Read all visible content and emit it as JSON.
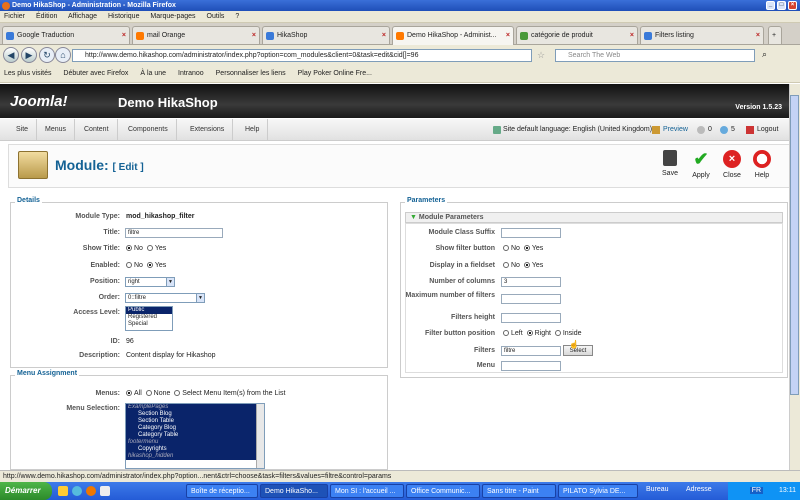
{
  "window": {
    "title": "Demo HikaShop - Administration - Mozilla Firefox"
  },
  "menubar": [
    "Fichier",
    "Édition",
    "Affichage",
    "Historique",
    "Marque-pages",
    "Outils",
    "?"
  ],
  "tabs": [
    {
      "label": "Google Traduction",
      "color": "#3a7ad9"
    },
    {
      "label": "mail Orange",
      "color": "#ff7900"
    },
    {
      "label": "HikaShop",
      "color": "#3a7ad9"
    },
    {
      "label": "Demo HikaShop - Administ...",
      "color": "#ff7900"
    },
    {
      "label": "catégorie de produit",
      "color": "#4a9a3a"
    },
    {
      "label": "Filters listing",
      "color": "#3a7ad9"
    }
  ],
  "url": "http://www.demo.hikashop.com/administrator/index.php?option=com_modules&client=0&task=edit&cid[]=96",
  "search_placeholder": "Search The Web",
  "bookmarks": [
    "Les plus visités",
    "Débuter avec Firefox",
    "À la une",
    "Intranoo",
    "Personnaliser les liens",
    "Play Poker Online Fre..."
  ],
  "joomla": {
    "logo": "Joomla!",
    "site": "Demo HikaShop",
    "version": "Version 1.5.23"
  },
  "admin_menu": [
    "Site",
    "Menus",
    "Content",
    "Components",
    "Extensions",
    "Help"
  ],
  "admin_right": {
    "lang": "Site default language: English (United Kingdom)",
    "preview": "Preview",
    "msgs": "0",
    "users": "5",
    "logout": "Logout"
  },
  "page": {
    "title": "Module:",
    "subtitle": "[ Edit ]"
  },
  "toolbar": {
    "save": "Save",
    "apply": "Apply",
    "close": "Close",
    "help": "Help"
  },
  "details": {
    "legend": "Details",
    "module_type_label": "Module Type:",
    "module_type": "mod_hikashop_filter",
    "title_label": "Title:",
    "title": "filtre",
    "show_title_label": "Show Title:",
    "enabled_label": "Enabled:",
    "position_label": "Position:",
    "position": "right",
    "order_label": "Order:",
    "order": "0::filtre",
    "access_label": "Access Level:",
    "access_options": [
      "Public",
      "Registered",
      "Special"
    ],
    "id_label": "ID:",
    "id": "96",
    "description_label": "Description:",
    "description": "Content display for Hikashop",
    "no": "No",
    "yes": "Yes"
  },
  "menu_assignment": {
    "legend": "Menu Assignment",
    "menus_label": "Menus:",
    "opt_all": "All",
    "opt_none": "None",
    "opt_select": "Select Menu Item(s) from the List",
    "selection_label": "Menu Selection:",
    "items": [
      {
        "label": "ExamplePages",
        "group": true
      },
      {
        "label": "Section Blog"
      },
      {
        "label": "Section Table"
      },
      {
        "label": "Category Blog"
      },
      {
        "label": "Category Table"
      },
      {
        "label": "footermenu",
        "group": true
      },
      {
        "label": "Copyrights"
      },
      {
        "label": "hikashop_hidden",
        "group": true
      }
    ]
  },
  "parameters": {
    "legend": "Parameters",
    "section": "Module Parameters",
    "class_suffix_label": "Module Class Suffix",
    "show_filter_btn_label": "Show filter button",
    "display_fieldset_label": "Display in a fieldset",
    "num_columns_label": "Number of columns",
    "num_columns": "3",
    "max_filters_label": "Maximum number of filters",
    "filters_height_label": "Filters height",
    "btn_position_label": "Filter button position",
    "left": "Left",
    "right": "Right",
    "inside": "Inside",
    "filters_label": "Filters",
    "filters": "filtre",
    "select_btn": "Select",
    "menu_label": "Menu",
    "no": "No",
    "yes": "Yes"
  },
  "statusbar": "http://www.demo.hikashop.com/administrator/index.php?option...nent&ctrl=choose&task=filters&values=filtre&control=params",
  "taskbar": {
    "start": "Démarrer",
    "tasks": [
      "Boîte de réceptio...",
      "Demo HikaSho...",
      "Mon SI : l'accueil ...",
      "Office Communic...",
      "Sans titre - Paint",
      "PILATO Sylvia DE..."
    ],
    "bureau": "Bureau",
    "adresse": "Adresse",
    "lang": "FR",
    "time": "13:11"
  }
}
